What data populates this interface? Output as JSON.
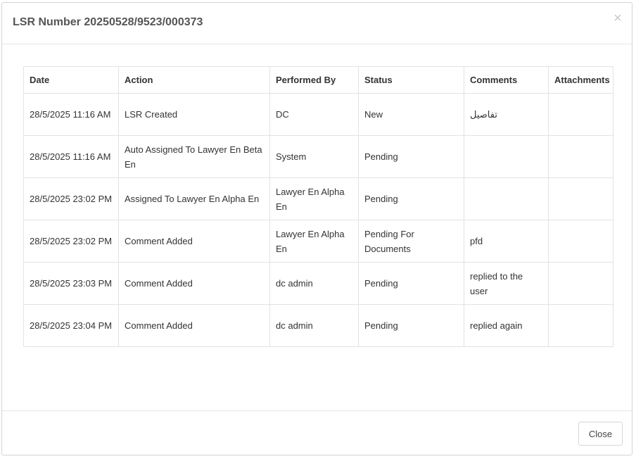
{
  "modal": {
    "title": "LSR Number 20250528/9523/000373",
    "close_icon": "close-icon",
    "close_glyph": "×",
    "close_button_label": "Close"
  },
  "table": {
    "columns": [
      "Date",
      "Action",
      "Performed By",
      "Status",
      "Comments",
      "Attachments"
    ],
    "rows": [
      {
        "date": "28/5/2025 11:16 AM",
        "action": "LSR Created",
        "performed_by": "DC",
        "status": "New",
        "comments": "تفاصيل",
        "attachments": ""
      },
      {
        "date": "28/5/2025 11:16 AM",
        "action": "Auto Assigned To Lawyer En Beta En",
        "performed_by": "System",
        "status": "Pending",
        "comments": "",
        "attachments": ""
      },
      {
        "date": "28/5/2025 23:02 PM",
        "action": "Assigned To Lawyer En Alpha En",
        "performed_by": "Lawyer En Alpha En",
        "status": "Pending",
        "comments": "",
        "attachments": ""
      },
      {
        "date": "28/5/2025 23:02 PM",
        "action": "Comment Added",
        "performed_by": "Lawyer En Alpha En",
        "status": "Pending For Documents",
        "comments": "pfd",
        "attachments": ""
      },
      {
        "date": "28/5/2025 23:03 PM",
        "action": "Comment Added",
        "performed_by": "dc admin",
        "status": "Pending",
        "comments": "replied to the user",
        "attachments": ""
      },
      {
        "date": "28/5/2025 23:04 PM",
        "action": "Comment Added",
        "performed_by": "dc admin",
        "status": "Pending",
        "comments": "replied again",
        "attachments": ""
      }
    ]
  }
}
